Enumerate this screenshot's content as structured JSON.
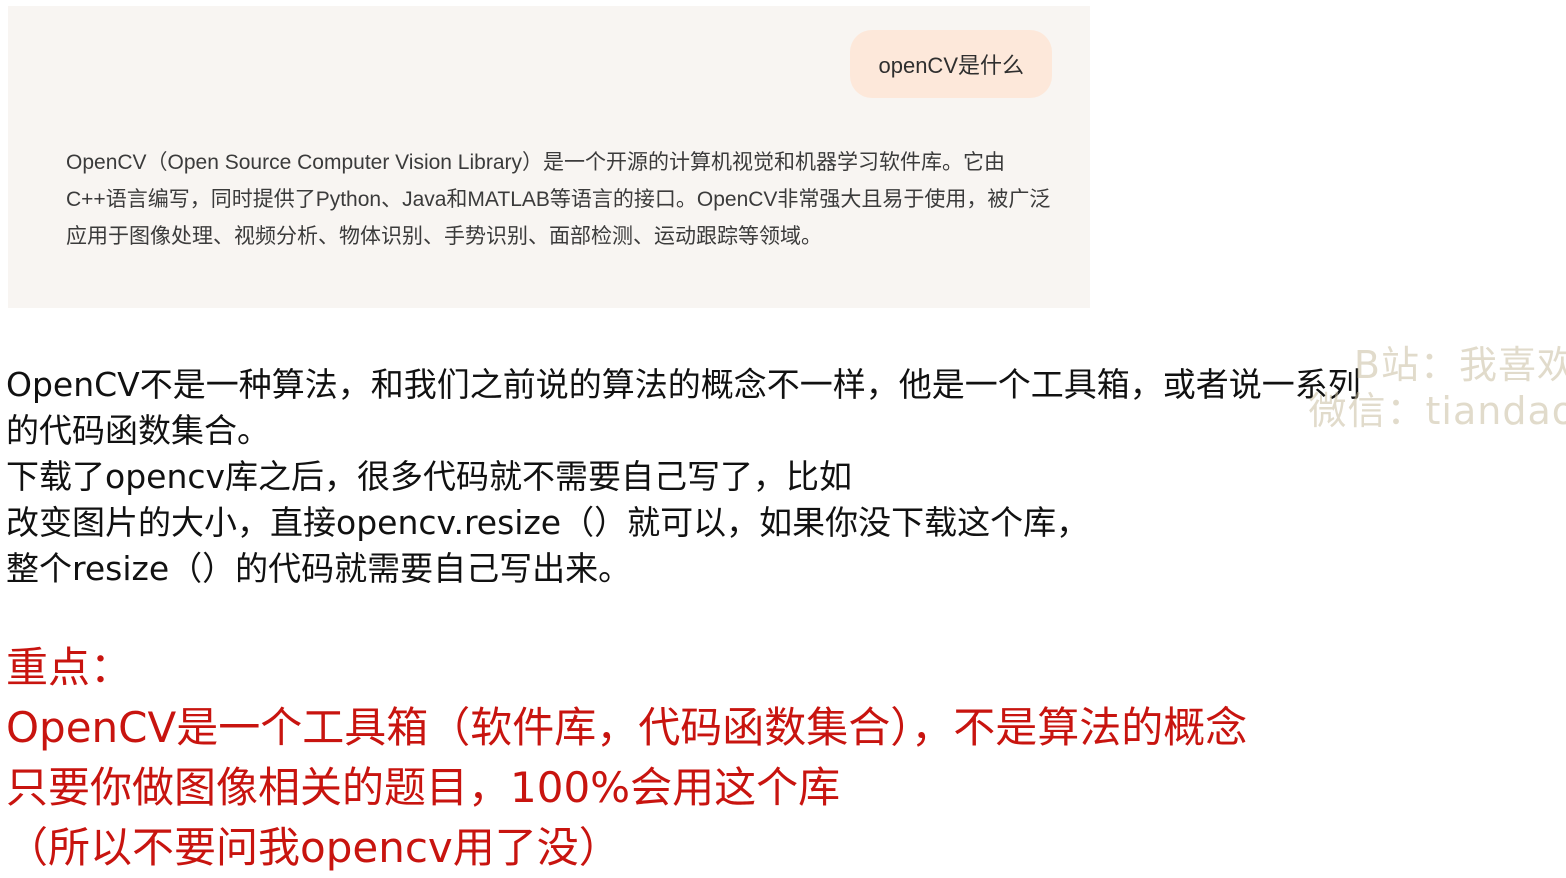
{
  "chat": {
    "user_message": "openCV是什么",
    "assistant_answer": "OpenCV（Open Source Computer Vision Library）是一个开源的计算机视觉和机器学习软件库。它由C++语言编写，同时提供了Python、Java和MATLAB等语言的接口。OpenCV非常强大且易于使用，被广泛应用于图像处理、视频分析、物体识别、手势识别、面部检测、运动跟踪等领域。"
  },
  "notes": {
    "lines": [
      "OpenCV不是一种算法，和我们之前说的算法的概念不一样，他是一个工具箱，或者说一系列",
      "的代码函数集合。",
      "下载了opencv库之后，很多代码就不需要自己写了，比如",
      "改变图片的大小，直接opencv.resize（）就可以，如果你没下载这个库，",
      "整个resize（）的代码就需要自己写出来。"
    ]
  },
  "key_points": {
    "heading": "重点：",
    "lines": [
      "OpenCV是一个工具箱（软件库，代码函数集合），不是算法的概念",
      "只要你做图像相关的题目，100%会用这个库",
      "（所以不要问我opencv用了没）"
    ]
  },
  "watermark": {
    "line1": "B站：我喜欢",
    "line2": "微信：tiandao"
  },
  "colors": {
    "panel_bg": "#f8f5f2",
    "bubble_bg": "#fde8da",
    "key_text": "#c8140f"
  }
}
